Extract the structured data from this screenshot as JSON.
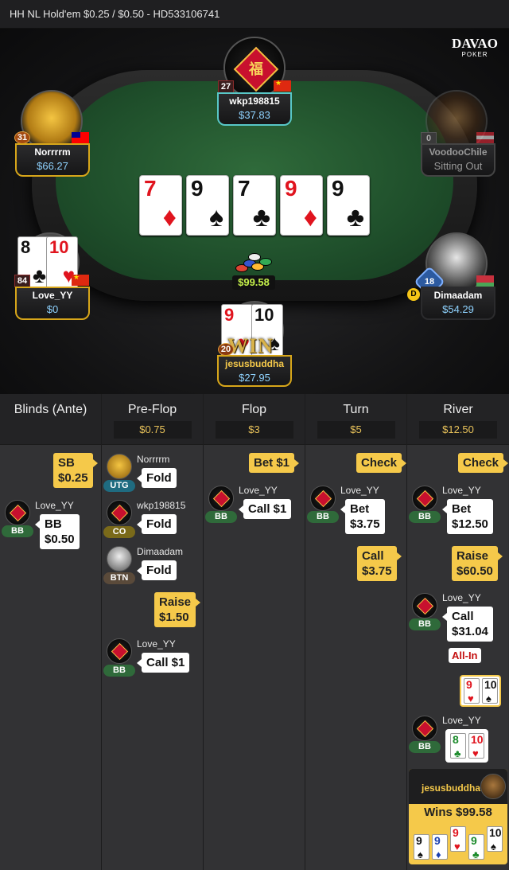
{
  "title_bar": {
    "text": "HH NL Hold'em $0.25 / $0.50   - HD533106741"
  },
  "logo": {
    "top": "DAVAO",
    "bottom": "POKER"
  },
  "table": {
    "pot": "$99.58",
    "win_label": "WIN",
    "board": [
      {
        "rank": "7",
        "suit": "♦",
        "color": "red"
      },
      {
        "rank": "9",
        "suit": "♠",
        "color": "blk"
      },
      {
        "rank": "7",
        "suit": "♣",
        "color": "blk"
      },
      {
        "rank": "9",
        "suit": "♦",
        "color": "red"
      },
      {
        "rank": "9",
        "suit": "♣",
        "color": "blk"
      }
    ],
    "dealer_button": "D",
    "seats": {
      "top": {
        "name": "wkp198815",
        "stack": "$37.83",
        "level": "27",
        "seal": "福"
      },
      "top_left": {
        "name": "Norrrrm",
        "stack": "$66.27",
        "level": "31"
      },
      "top_right": {
        "name": "VoodooChile",
        "stack": "Sitting Out",
        "level": "0"
      },
      "left": {
        "name": "Love_YY",
        "stack": "$0",
        "level": "84",
        "cards": [
          {
            "rank": "8",
            "suit": "♣"
          },
          {
            "rank": "10",
            "suit": "♥"
          }
        ]
      },
      "right": {
        "name": "Dimaadam",
        "stack": "$54.29",
        "level": "18"
      },
      "bottom": {
        "name": "jesusbuddha",
        "stack": "$27.95",
        "level": "20",
        "cards": [
          {
            "rank": "9",
            "suit": "♥"
          },
          {
            "rank": "10",
            "suit": "♠"
          }
        ]
      }
    }
  },
  "history": {
    "columns": [
      {
        "title": "Blinds (Ante)",
        "pot": ""
      },
      {
        "title": "Pre-Flop",
        "pot": "$0.75"
      },
      {
        "title": "Flop",
        "pot": "$3"
      },
      {
        "title": "Turn",
        "pot": "$5"
      },
      {
        "title": "River",
        "pot": "$12.50"
      }
    ],
    "blinds": {
      "sb": {
        "label": "SB",
        "amount": "$0.25"
      },
      "bb": {
        "player": "Love_YY",
        "pos": "BB",
        "label": "BB",
        "amount": "$0.50"
      }
    },
    "preflop": [
      {
        "player": "Norrrrm",
        "pos": "UTG",
        "action": "Fold"
      },
      {
        "player": "wkp198815",
        "pos": "CO",
        "action": "Fold"
      },
      {
        "player": "Dimaadam",
        "pos": "BTN",
        "action": "Fold"
      },
      {
        "action": "Raise",
        "amount": "$1.50"
      },
      {
        "player": "Love_YY",
        "pos": "BB",
        "action": "Call $1"
      }
    ],
    "flop": [
      {
        "action": "Bet  $1"
      },
      {
        "player": "Love_YY",
        "pos": "BB",
        "action": "Call  $1"
      }
    ],
    "turn": [
      {
        "action": "Check"
      },
      {
        "player": "Love_YY",
        "pos": "BB",
        "action": "Bet",
        "amount": "$3.75"
      },
      {
        "action": "Call",
        "amount": "$3.75"
      }
    ],
    "river": [
      {
        "action": "Check"
      },
      {
        "player": "Love_YY",
        "pos": "BB",
        "action": "Bet",
        "amount": "$12.50"
      },
      {
        "action": "Raise",
        "amount": "$60.50"
      },
      {
        "player": "Love_YY",
        "pos": "BB",
        "action": "Call",
        "amount": "$31.04",
        "tag": "All-In"
      },
      {
        "show_cards": [
          {
            "rank": "9",
            "suit": "♥"
          },
          {
            "rank": "10",
            "suit": "♠"
          }
        ]
      },
      {
        "player": "Love_YY",
        "pos": "BB",
        "show_cards": [
          {
            "rank": "8",
            "suit": "♣"
          },
          {
            "rank": "10",
            "suit": "♥"
          }
        ]
      },
      {
        "winner": "jesusbuddha",
        "result": "Wins $99.58",
        "hand": [
          {
            "rank": "9",
            "suit": "♠"
          },
          {
            "rank": "9",
            "suit": "♦"
          },
          {
            "rank": "9",
            "suit": "♥"
          },
          {
            "rank": "9",
            "suit": "♣"
          },
          {
            "rank": "10",
            "suit": "♠"
          }
        ]
      }
    ]
  }
}
